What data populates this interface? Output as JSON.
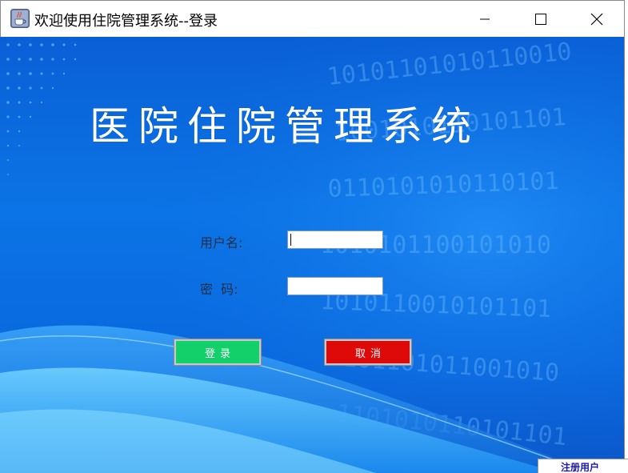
{
  "window": {
    "title": "欢迎使用住院管理系统--登录",
    "icon": "java-coffee-cup-icon",
    "controls": {
      "minimize": "minimize-icon",
      "maximize": "maximize-icon",
      "close": "close-icon"
    }
  },
  "main": {
    "heading": "医院住院管理系统",
    "form": {
      "username_label": "用户名:",
      "username_value": "",
      "password_label": "密  码:",
      "password_value": ""
    },
    "buttons": {
      "login_label": "登录",
      "cancel_label": "取消"
    }
  },
  "background_window": {
    "register_label": "注册用户"
  },
  "colors": {
    "background_blue": "#0b6fe3",
    "login_button": "#13d06a",
    "cancel_button": "#de0a0a",
    "heading_text": "#ffffff",
    "label_text": "#222f4a"
  }
}
